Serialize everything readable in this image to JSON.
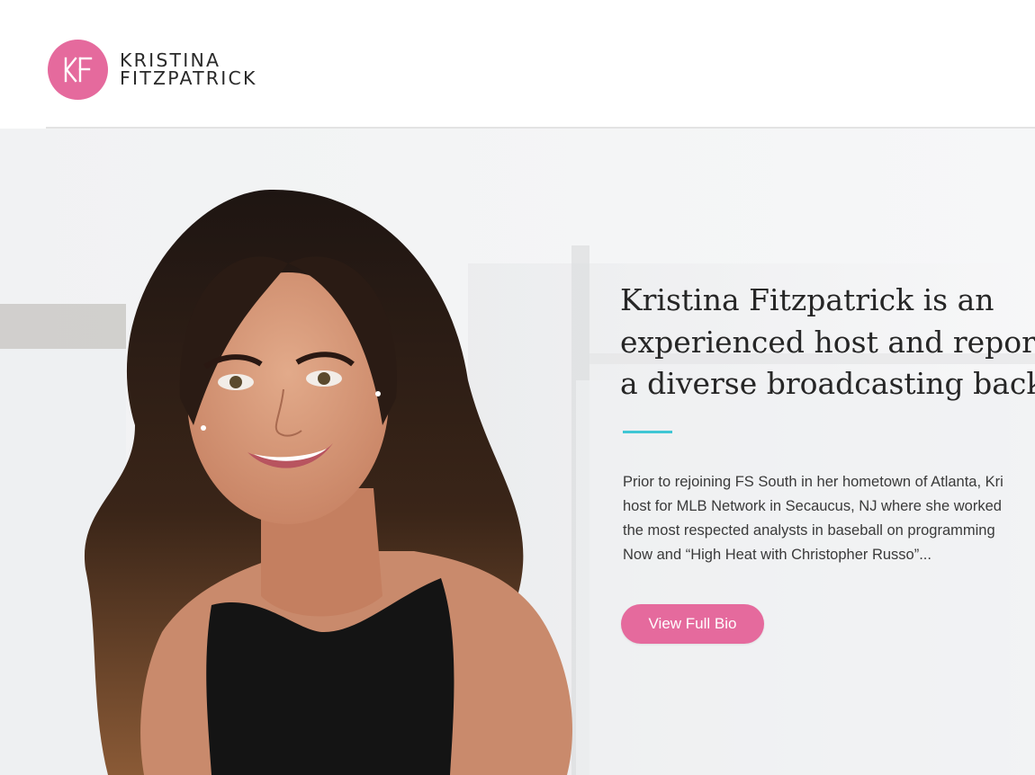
{
  "brand": {
    "monogram": "KF",
    "name_line1": "KRISTINA",
    "name_line2": "FITZPATRICK"
  },
  "hero": {
    "headline_lines": [
      "Kristina Fitzpatrick is an",
      "experienced host and reporte",
      "a diverse broadcasting backg"
    ],
    "bio_lines": [
      "Prior to rejoining FS South in her hometown of Atlanta, Kri",
      "host for MLB Network in Secaucus, NJ where she worked",
      "the most respected analysts in baseball on programming",
      "Now and “High Heat with Christopher Russo”..."
    ],
    "cta_label": "View Full Bio",
    "photo": "portrait of smiling woman with long dark wavy hair in black sleeveless top"
  },
  "colors": {
    "brand_pink": "#e56a9d",
    "accent_teal": "#3fc6d4",
    "text_dark": "#262626"
  }
}
